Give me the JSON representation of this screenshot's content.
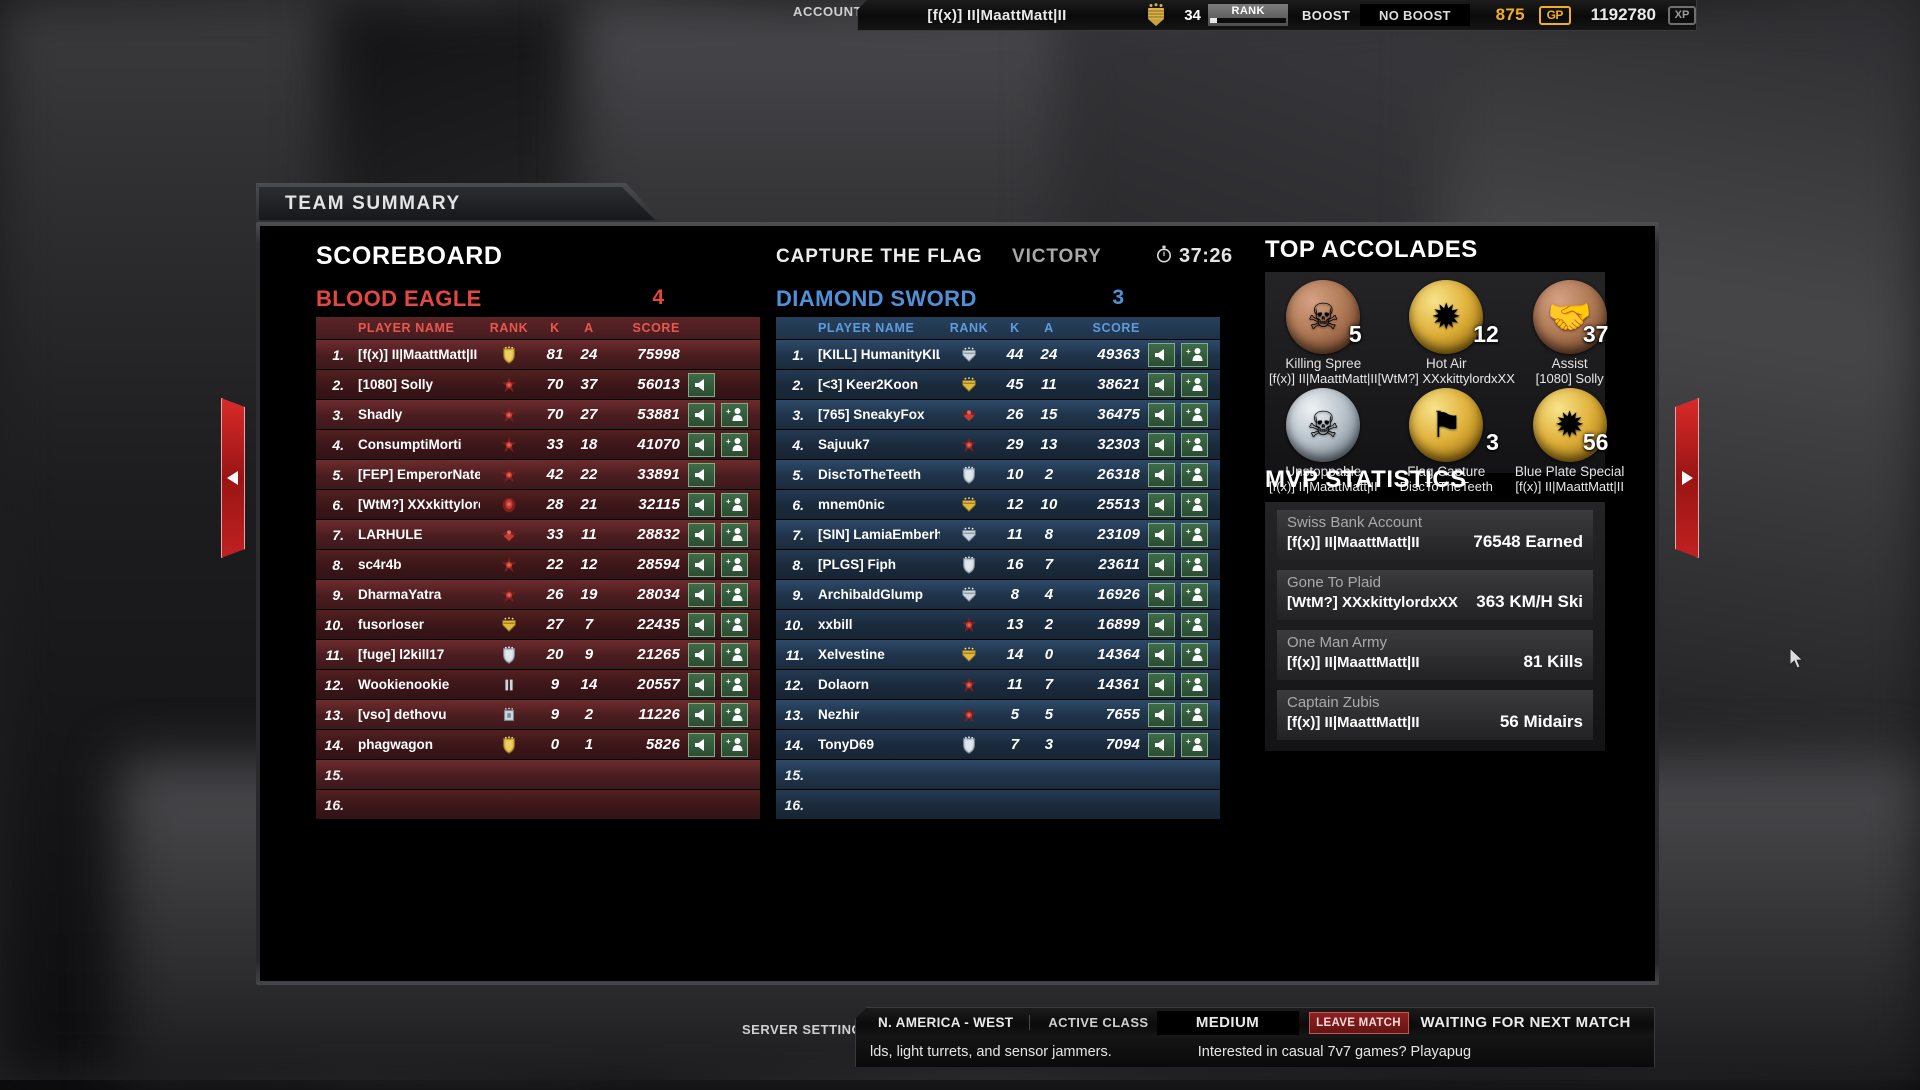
{
  "topbar": {
    "account_label": "ACCOUNT",
    "player_name": "[f(x)] II|MaattMatt|II",
    "rank_number": "34",
    "rank_label": "RANK",
    "boost_label": "BOOST",
    "boost_value": "NO BOOST",
    "gold": "875",
    "gold_currency": "GP",
    "xp": "1192780",
    "xp_currency": "XP"
  },
  "window": {
    "tab_title": "TEAM SUMMARY",
    "scoreboard_title": "SCOREBOARD",
    "game_mode": "CAPTURE THE FLAG",
    "result": "VICTORY",
    "clock_icon": "stopwatch-icon",
    "match_time": "37:26"
  },
  "columns": {
    "player_name": "PLAYER NAME",
    "rank": "RANK",
    "kills": "K",
    "assists": "A",
    "score": "SCORE"
  },
  "teams": [
    {
      "key": "eagle",
      "name": "BLOOD EAGLE",
      "score": "4",
      "color": "#e3473f",
      "players": [
        {
          "pos": "1.",
          "name": "[f(x)] II|MaattMatt|II",
          "rank_icon": "gold-shield-rank-icon",
          "rank_tier": "gold",
          "k": "81",
          "a": "24",
          "score": "75998",
          "mute": false,
          "add": false
        },
        {
          "pos": "2.",
          "name": "[1080] Solly",
          "rank_icon": "red-star-rank-icon",
          "rank_tier": "red",
          "k": "70",
          "a": "37",
          "score": "56013",
          "mute": true,
          "add": false
        },
        {
          "pos": "3.",
          "name": "Shadly",
          "rank_icon": "red-star-rank-icon",
          "rank_tier": "red",
          "k": "70",
          "a": "27",
          "score": "53881",
          "mute": true,
          "add": true
        },
        {
          "pos": "4.",
          "name": "ConsumptiMorti",
          "rank_icon": "red-star-rank-icon",
          "rank_tier": "red",
          "k": "33",
          "a": "18",
          "score": "41070",
          "mute": true,
          "add": true
        },
        {
          "pos": "5.",
          "name": "[FEP] EmperorNate",
          "rank_icon": "red-star-rank-icon",
          "rank_tier": "red",
          "k": "42",
          "a": "22",
          "score": "33891",
          "mute": true,
          "add": false
        },
        {
          "pos": "6.",
          "name": "[WtM?] XXxkittylordxXX",
          "rank_icon": "red-crest-rank-icon",
          "rank_tier": "red",
          "k": "28",
          "a": "21",
          "score": "32115",
          "mute": true,
          "add": true
        },
        {
          "pos": "7.",
          "name": "LARHULE",
          "rank_icon": "red-wing-rank-icon",
          "rank_tier": "red",
          "k": "33",
          "a": "11",
          "score": "28832",
          "mute": true,
          "add": true
        },
        {
          "pos": "8.",
          "name": "sc4r4b",
          "rank_icon": "red-star-rank-icon",
          "rank_tier": "red",
          "k": "22",
          "a": "12",
          "score": "28594",
          "mute": true,
          "add": true
        },
        {
          "pos": "9.",
          "name": "DharmaYatra",
          "rank_icon": "red-star-rank-icon",
          "rank_tier": "red",
          "k": "26",
          "a": "19",
          "score": "28034",
          "mute": true,
          "add": true
        },
        {
          "pos": "10.",
          "name": "fusorloser",
          "rank_icon": "gold-chevron-rank-icon",
          "rank_tier": "gold",
          "k": "27",
          "a": "7",
          "score": "22435",
          "mute": true,
          "add": true
        },
        {
          "pos": "11.",
          "name": "[fuge] l2kill17",
          "rank_icon": "silver-shield-rank-icon",
          "rank_tier": "silver",
          "k": "20",
          "a": "9",
          "score": "21265",
          "mute": true,
          "add": true
        },
        {
          "pos": "12.",
          "name": "Wookienookie",
          "rank_icon": "silver-bar-rank-icon",
          "rank_tier": "silver",
          "k": "9",
          "a": "14",
          "score": "20557",
          "mute": true,
          "add": true
        },
        {
          "pos": "13.",
          "name": "[vso] dethovu",
          "rank_icon": "silver-box-rank-icon",
          "rank_tier": "silver",
          "k": "9",
          "a": "2",
          "score": "11226",
          "mute": true,
          "add": true
        },
        {
          "pos": "14.",
          "name": "phagwagon",
          "rank_icon": "gold-shield-rank-icon",
          "rank_tier": "gold",
          "k": "0",
          "a": "1",
          "score": "5826",
          "mute": true,
          "add": true
        },
        {
          "pos": "15.",
          "name": "",
          "rank_icon": "",
          "rank_tier": "",
          "k": "",
          "a": "",
          "score": "",
          "mute": false,
          "add": false
        },
        {
          "pos": "16.",
          "name": "",
          "rank_icon": "",
          "rank_tier": "",
          "k": "",
          "a": "",
          "score": "",
          "mute": false,
          "add": false
        }
      ]
    },
    {
      "key": "sword",
      "name": "DIAMOND SWORD",
      "score": "3",
      "color": "#4f91d8",
      "players": [
        {
          "pos": "1.",
          "name": "[KILL] HumanityKILLS",
          "rank_icon": "silver-chevron-rank-icon",
          "rank_tier": "silver",
          "k": "44",
          "a": "24",
          "score": "49363",
          "mute": true,
          "add": true
        },
        {
          "pos": "2.",
          "name": "[<3] Keer2Koon",
          "rank_icon": "gold-chevron-rank-icon",
          "rank_tier": "gold",
          "k": "45",
          "a": "11",
          "score": "38621",
          "mute": true,
          "add": true
        },
        {
          "pos": "3.",
          "name": "[765] SneakyFox",
          "rank_icon": "red-wing-rank-icon",
          "rank_tier": "red",
          "k": "26",
          "a": "15",
          "score": "36475",
          "mute": true,
          "add": true
        },
        {
          "pos": "4.",
          "name": "Sajuuk7",
          "rank_icon": "red-star-rank-icon",
          "rank_tier": "red",
          "k": "29",
          "a": "13",
          "score": "32303",
          "mute": true,
          "add": true
        },
        {
          "pos": "5.",
          "name": "DiscToTheTeeth",
          "rank_icon": "silver-shield-rank-icon",
          "rank_tier": "silver",
          "k": "10",
          "a": "2",
          "score": "26318",
          "mute": true,
          "add": true
        },
        {
          "pos": "6.",
          "name": "mnem0nic",
          "rank_icon": "gold-chevron-rank-icon",
          "rank_tier": "gold",
          "k": "12",
          "a": "10",
          "score": "25513",
          "mute": true,
          "add": true
        },
        {
          "pos": "7.",
          "name": "[SIN] LamiaEmberheart",
          "rank_icon": "silver-chevron-rank-icon",
          "rank_tier": "silver",
          "k": "11",
          "a": "8",
          "score": "23109",
          "mute": true,
          "add": true
        },
        {
          "pos": "8.",
          "name": "[PLGS] Fiph",
          "rank_icon": "silver-shield-rank-icon",
          "rank_tier": "silver",
          "k": "16",
          "a": "7",
          "score": "23611",
          "mute": true,
          "add": true
        },
        {
          "pos": "9.",
          "name": "ArchibaldGlump",
          "rank_icon": "silver-chevron-rank-icon",
          "rank_tier": "silver",
          "k": "8",
          "a": "4",
          "score": "16926",
          "mute": true,
          "add": true
        },
        {
          "pos": "10.",
          "name": "xxbill",
          "rank_icon": "red-star-rank-icon",
          "rank_tier": "red",
          "k": "13",
          "a": "2",
          "score": "16899",
          "mute": true,
          "add": true
        },
        {
          "pos": "11.",
          "name": "Xelvestine",
          "rank_icon": "gold-chevron-rank-icon",
          "rank_tier": "gold",
          "k": "14",
          "a": "0",
          "score": "14364",
          "mute": true,
          "add": true
        },
        {
          "pos": "12.",
          "name": "Dolaorn",
          "rank_icon": "red-star-rank-icon",
          "rank_tier": "red",
          "k": "11",
          "a": "7",
          "score": "14361",
          "mute": true,
          "add": true
        },
        {
          "pos": "13.",
          "name": "Nezhir",
          "rank_icon": "red-star-rank-icon",
          "rank_tier": "red",
          "k": "5",
          "a": "5",
          "score": "7655",
          "mute": true,
          "add": true
        },
        {
          "pos": "14.",
          "name": "TonyD69",
          "rank_icon": "silver-shield-rank-icon",
          "rank_tier": "silver",
          "k": "7",
          "a": "3",
          "score": "7094",
          "mute": true,
          "add": true
        },
        {
          "pos": "15.",
          "name": "",
          "rank_icon": "",
          "rank_tier": "",
          "k": "",
          "a": "",
          "score": "",
          "mute": false,
          "add": false
        },
        {
          "pos": "16.",
          "name": "",
          "rank_icon": "",
          "rank_tier": "",
          "k": "",
          "a": "",
          "score": "",
          "mute": false,
          "add": false
        }
      ]
    }
  ],
  "accolades": {
    "title": "TOP ACCOLADES",
    "items": [
      {
        "name": "Killing Spree",
        "player": "[f(x)] II|MaattMatt|II",
        "count": "5",
        "medal": "bronze",
        "icon": "skull-star-medal-icon",
        "glyph": "☠"
      },
      {
        "name": "Hot Air",
        "player": "[WtM?] XXxkittylordxXX",
        "count": "12",
        "medal": "gold",
        "icon": "sunburst-medal-icon",
        "glyph": "✹"
      },
      {
        "name": "Assist",
        "player": "[1080] Solly",
        "count": "37",
        "medal": "bronze",
        "icon": "handshake-medal-icon",
        "glyph": "🤝"
      },
      {
        "name": "Unstoppable",
        "player": "[f(x)] II|MaattMatt|II",
        "count": "",
        "medal": "silver",
        "icon": "skull-wreath-medal-icon",
        "glyph": "☠"
      },
      {
        "name": "Flag Capture",
        "player": "DiscToTheTeeth",
        "count": "3",
        "medal": "gold",
        "icon": "flag-medal-icon",
        "glyph": "⚑"
      },
      {
        "name": "Blue Plate Special",
        "player": "[f(x)] II|MaattMatt|II",
        "count": "56",
        "medal": "gold",
        "icon": "blue-burst-medal-icon",
        "glyph": "✹"
      }
    ]
  },
  "mvp": {
    "title": "MVP STATISTICS",
    "items": [
      {
        "label": "Swiss Bank Account",
        "player": "[f(x)] II|MaattMatt|II",
        "value": "76548 Earned"
      },
      {
        "label": "Gone To Plaid",
        "player": "[WtM?] XXxkittylordxXX",
        "value": "363 KM/H Ski"
      },
      {
        "label": "One Man Army",
        "player": "[f(x)] II|MaattMatt|II",
        "value": "81 Kills"
      },
      {
        "label": "Captain Zubis",
        "player": "[f(x)] II|MaattMatt|II",
        "value": "56 Midairs"
      }
    ]
  },
  "nav": {
    "prev_icon": "left-arrow-icon",
    "next_icon": "right-arrow-icon"
  },
  "bottombar": {
    "server_settings_label": "SERVER SETTINGS",
    "region": "N. AMERICA - WEST",
    "active_class_label": "ACTIVE CLASS",
    "active_class_value": "MEDIUM",
    "leave_match": "LEAVE MATCH",
    "status": "WAITING FOR NEXT MATCH",
    "chat_line_left": "lds, light turrets, and sensor jammers.",
    "chat_line_right": "Interested in casual 7v7 games? Playapug"
  },
  "colors": {
    "blood_eagle": "#e3473f",
    "diamond_sword": "#4f91d8",
    "gold": "#f2b01e",
    "leave_match_red": "#8e2020",
    "action_green": "#3e6b47"
  }
}
